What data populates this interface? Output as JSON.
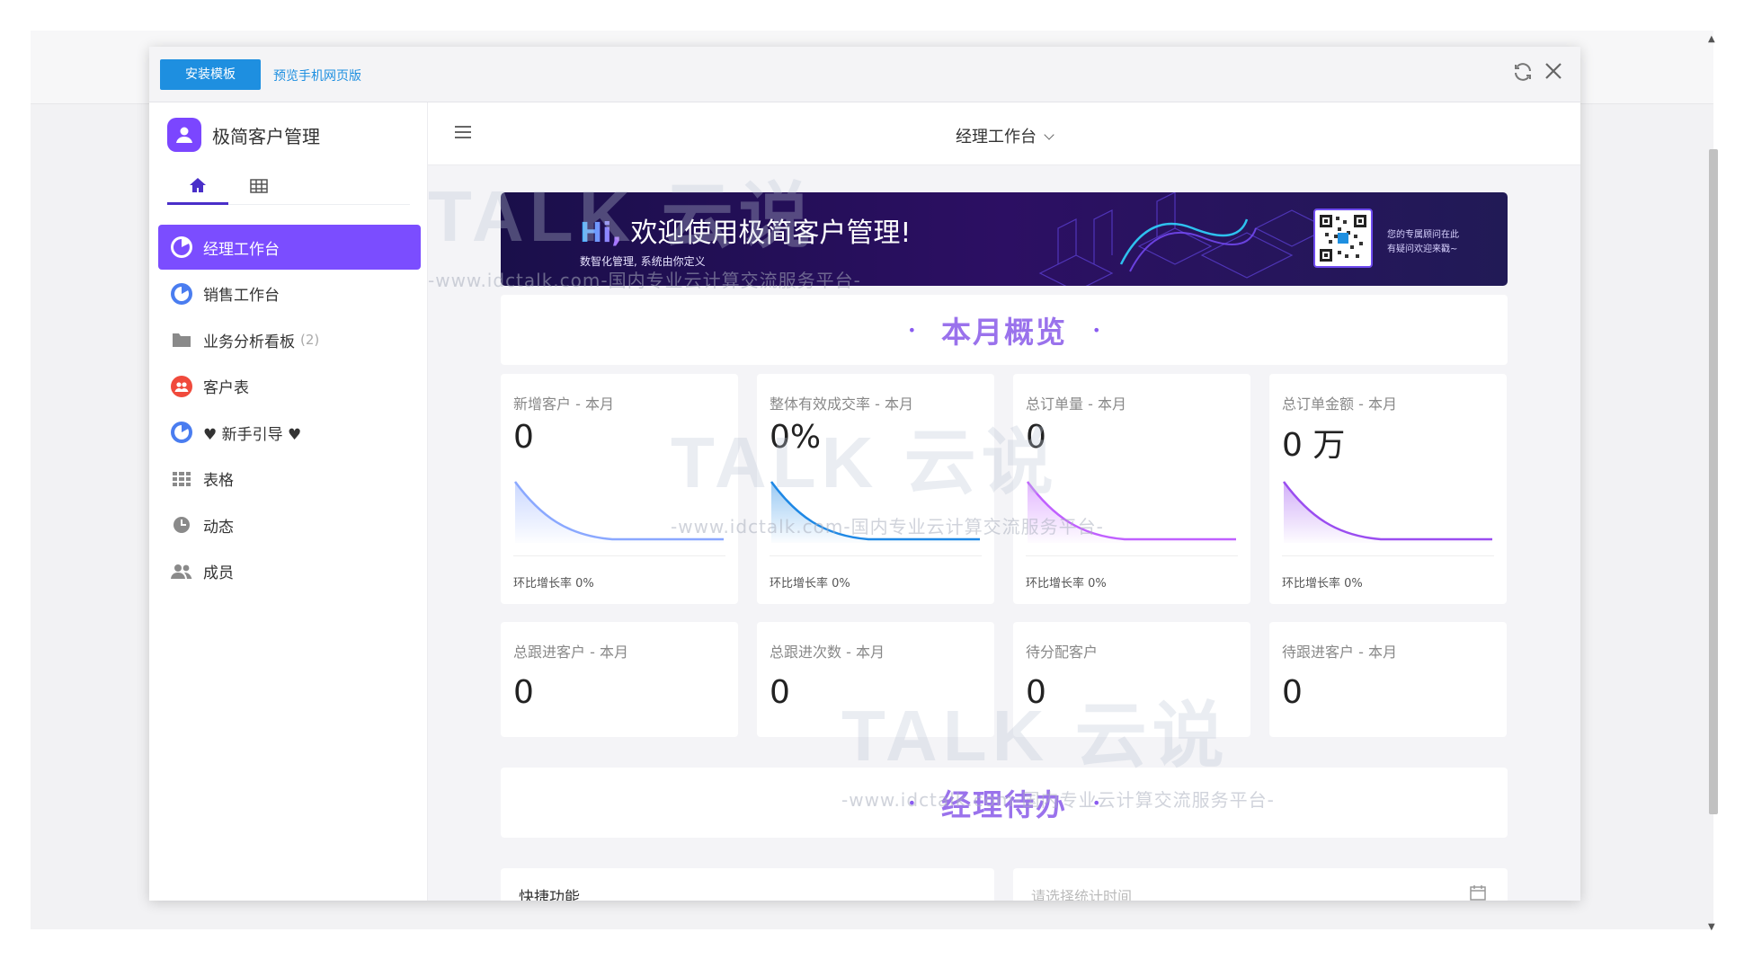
{
  "toolbar": {
    "install_label": "安装模板",
    "preview_label": "预览手机网页版",
    "refresh_icon": "refresh-icon",
    "close_icon": "close-icon"
  },
  "sidebar": {
    "brand_name": "极简客户管理",
    "tabs": [
      {
        "icon": "home-icon",
        "active": true
      },
      {
        "icon": "table-icon",
        "active": false
      }
    ],
    "items": [
      {
        "label": "经理工作台",
        "icon": "pie-chart-icon",
        "active": true
      },
      {
        "label": "销售工作台",
        "icon": "pie-chart-icon",
        "active": false
      },
      {
        "label": "业务分析看板",
        "count": "(2)",
        "icon": "folder-icon",
        "active": false
      },
      {
        "label": "客户表",
        "icon": "users-icon",
        "active": false
      },
      {
        "label": "♥ 新手引导 ♥",
        "icon": "pie-chart-icon",
        "active": false
      },
      {
        "label": "表格",
        "icon": "grid-icon",
        "active": false
      },
      {
        "label": "动态",
        "icon": "clock-icon",
        "active": false
      },
      {
        "label": "成员",
        "icon": "members-icon",
        "active": false
      }
    ]
  },
  "header": {
    "title": "经理工作台",
    "menu_icon": "hamburger-icon"
  },
  "banner": {
    "hi": "Hi,",
    "greeting": " 欢迎使用极简客户管理!",
    "subtitle": "数智化管理, 系统由你定义",
    "qr_note_line1": "您的专属顾问在此",
    "qr_note_line2": "有疑问欢迎来戳~"
  },
  "sections": {
    "overview_title": "本月概览",
    "todo_title": "经理待办",
    "dot": "•"
  },
  "stats_row1": [
    {
      "label": "新增客户 - 本月",
      "value": "0",
      "footer": "环比增长率 0%",
      "color": "#8aa8ff"
    },
    {
      "label": "整体有效成交率 - 本月",
      "value": "0%",
      "footer": "环比增长率 0%",
      "color": "#1e88e5"
    },
    {
      "label": "总订单量 - 本月",
      "value": "0",
      "footer": "环比增长率 0%",
      "color": "#c060ff"
    },
    {
      "label": "总订单金额 - 本月",
      "value": "0 万",
      "footer": "环比增长率 0%",
      "color": "#9a4df0"
    }
  ],
  "stats_row2": [
    {
      "label": "总跟进客户 - 本月",
      "value": "0"
    },
    {
      "label": "总跟进次数 - 本月",
      "value": "0"
    },
    {
      "label": "待分配客户",
      "value": "0"
    },
    {
      "label": "待跟进客户 - 本月",
      "value": "0"
    }
  ],
  "bottom": {
    "quick_title": "快捷功能",
    "date_placeholder": "请选择统计时间"
  },
  "watermark": {
    "brand": "TALK 云说",
    "sub": "-www.idctalk.com-国内专业云计算交流服务平台-"
  },
  "colors": {
    "accent": "#7b4dff",
    "install_button": "#1e8fe0",
    "section_title": "#9a72ec"
  }
}
